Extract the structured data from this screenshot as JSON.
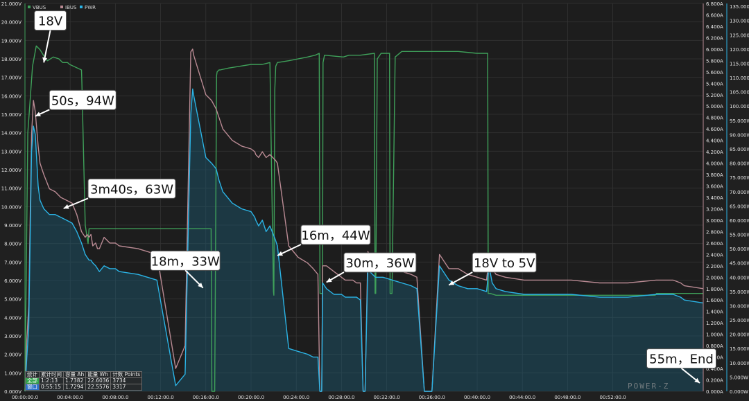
{
  "chart_data": {
    "type": "line",
    "x_unit": "elapsed time (hh:mm:ss)",
    "x_ticks": [
      "00:00:00.0",
      "00:04:00.0",
      "00:08:00.0",
      "00:12:00.0",
      "00:16:00.0",
      "00:20:00.0",
      "00:24:00.0",
      "00:28:00.0",
      "00:32:00.0",
      "00:36:00.0",
      "00:40:00.0",
      "00:44:00.0",
      "00:48:00.0",
      "00:52:00.0"
    ],
    "xlim_seconds": [
      0,
      3600
    ],
    "y_left": {
      "ylim": [
        0,
        21
      ],
      "ticks": [
        "0.000V",
        "1.000V",
        "2.000V",
        "3.000V",
        "4.000V",
        "5.000V",
        "6.000V",
        "7.000V",
        "8.000V",
        "9.000V",
        "10.000V",
        "11.000V",
        "12.000V",
        "13.000V",
        "14.000V",
        "15.000V",
        "16.000V",
        "17.000V",
        "18.000V",
        "19.000V",
        "20.000V",
        "21.000V"
      ]
    },
    "y_right1": {
      "ylim": [
        0,
        6.8
      ],
      "ticks": [
        "0.000A",
        "0.200A",
        "0.400A",
        "0.600A",
        "0.800A",
        "1.000A",
        "1.200A",
        "1.400A",
        "1.600A",
        "1.800A",
        "2.000A",
        "2.200A",
        "2.400A",
        "2.600A",
        "2.800A",
        "3.000A",
        "3.200A",
        "3.400A",
        "3.600A",
        "3.800A",
        "4.000A",
        "4.200A",
        "4.400A",
        "4.600A",
        "4.800A",
        "5.000A",
        "5.200A",
        "5.400A",
        "5.600A",
        "5.800A",
        "6.000A",
        "6.200A",
        "6.400A",
        "6.600A",
        "6.800A"
      ]
    },
    "y_right2": {
      "ylim": [
        0,
        136
      ],
      "ticks": [
        "0.000W",
        "5.000W",
        "10.000W",
        "15.000W",
        "20.000W",
        "25.000W",
        "30.000W",
        "35.000W",
        "40.000W",
        "45.000W",
        "50.000W",
        "55.000W",
        "60.000W",
        "65.000W",
        "70.000W",
        "75.000W",
        "80.000W",
        "85.000W",
        "90.000W",
        "95.000W",
        "100.000W",
        "105.000W",
        "110.000W",
        "115.000W",
        "120.000W",
        "125.000W",
        "130.000W",
        "135.000W"
      ]
    },
    "legend": [
      "VBUS",
      "IBUS",
      "PWR"
    ],
    "grid": true,
    "series": [
      {
        "name": "VBUS",
        "axis": "V",
        "color": "#3fa15a",
        "x": [
          0,
          15,
          40,
          60,
          80,
          110,
          120,
          150,
          180,
          200,
          226,
          237,
          300,
          302,
          320,
          335,
          340,
          390,
          420,
          450,
          480,
          500,
          522,
          534,
          545,
          560,
          600,
          700,
          800,
          900,
          950,
          988,
          992,
          1007,
          1017,
          1020,
          1030,
          1036,
          1080,
          1140,
          1200,
          1260,
          1300,
          1319,
          1321,
          1326,
          1331,
          1340,
          1400,
          1500,
          1540,
          1562,
          1566,
          1579,
          1582,
          1590,
          1690,
          1720,
          1740,
          1780,
          1855,
          1858,
          1862,
          1870,
          1890,
          1910,
          1935,
          1938,
          1948,
          1965,
          2000,
          2100,
          2200,
          2300,
          2400,
          2456,
          2459,
          2470,
          2500,
          2700,
          3000,
          3300,
          3345,
          3352,
          3360,
          3400,
          3500,
          3600
        ],
        "y": [
          0,
          14.0,
          17.6,
          18.7,
          18.5,
          18.0,
          17.9,
          18.1,
          18.0,
          17.8,
          17.8,
          17.7,
          17.4,
          16.8,
          9.0,
          8.0,
          8.8,
          8.8,
          8.8,
          8.8,
          8.8,
          8.8,
          8.8,
          8.8,
          8.8,
          8.8,
          8.8,
          8.8,
          8.8,
          8.8,
          8.8,
          8.8,
          0,
          0,
          17.1,
          17.3,
          17.4,
          17.4,
          17.5,
          17.6,
          17.7,
          17.7,
          17.8,
          5.4,
          5.2,
          16.3,
          17.6,
          17.8,
          17.9,
          18.1,
          18.2,
          18.3,
          5.3,
          5.3,
          17.8,
          18.2,
          18.1,
          18.2,
          18.2,
          18.2,
          18.3,
          5.3,
          5.3,
          18.0,
          18.3,
          18.3,
          18.3,
          5.3,
          5.3,
          18.1,
          18.4,
          18.4,
          18.4,
          18.4,
          18.3,
          18.3,
          5.3,
          5.3,
          5.2,
          5.2,
          5.2,
          5.2,
          5.2,
          5.3,
          5.3,
          5.3,
          5.3,
          5.3
        ]
      },
      {
        "name": "IBUS",
        "axis": "A",
        "color": "#b98a93",
        "x": [
          0,
          10,
          20,
          35,
          45,
          55,
          70,
          80,
          100,
          130,
          160,
          190,
          220,
          250,
          275,
          300,
          320,
          330,
          340,
          350,
          360,
          375,
          385,
          395,
          420,
          450,
          480,
          500,
          600,
          700,
          800,
          850,
          880,
          890,
          895,
          960,
          990,
          1015,
          1030,
          1050,
          1100,
          1150,
          1200,
          1220,
          1225,
          1240,
          1260,
          1280,
          1300,
          1330,
          1340,
          1400,
          1450,
          1500,
          1530,
          1555,
          1565,
          1575,
          1580,
          1600,
          1640,
          1680,
          1700,
          1725,
          1740,
          1760,
          1780,
          1795,
          1805,
          1820,
          1830,
          1860,
          1900,
          1950,
          2000,
          2050,
          2080,
          2120,
          2160,
          2200,
          2250,
          2300,
          2350,
          2400,
          2450,
          2463,
          2480,
          2500,
          2550,
          2650,
          2750,
          2900,
          3050,
          3200,
          3350,
          3440,
          3480,
          3500,
          3600
        ],
        "y": [
          0,
          0.9,
          1.5,
          4.5,
          5.1,
          4.9,
          4.3,
          4.0,
          3.8,
          3.55,
          3.5,
          3.4,
          3.35,
          3.3,
          3.1,
          2.8,
          2.7,
          2.75,
          2.7,
          2.75,
          2.55,
          2.6,
          2.5,
          2.5,
          2.7,
          2.6,
          2.6,
          2.55,
          2.5,
          2.4,
          0.4,
          0.8,
          5.95,
          6.0,
          5.9,
          5.2,
          5.1,
          4.95,
          4.8,
          4.6,
          4.4,
          4.3,
          4.25,
          4.2,
          4.15,
          4.1,
          4.2,
          4.1,
          4.15,
          4.05,
          4.0,
          2.55,
          2.35,
          2.25,
          2.15,
          2.05,
          0,
          0,
          2.2,
          2.2,
          2.1,
          2.0,
          1.95,
          1.95,
          1.95,
          1.9,
          1.9,
          0,
          0,
          2.45,
          2.4,
          2.3,
          2.25,
          2.2,
          2.1,
          2.05,
          2.0,
          0,
          0,
          2.4,
          2.15,
          2.15,
          2.05,
          2.0,
          1.95,
          2.35,
          2.15,
          2.05,
          2.0,
          1.95,
          1.95,
          1.95,
          1.9,
          1.9,
          1.95,
          1.95,
          1.9,
          1.85,
          1.8
        ]
      },
      {
        "name": "PWR",
        "axis": "W",
        "color": "#2bb4e6",
        "x": [
          0,
          10,
          20,
          35,
          45,
          55,
          70,
          80,
          100,
          130,
          160,
          190,
          220,
          250,
          275,
          300,
          320,
          330,
          340,
          350,
          360,
          375,
          385,
          395,
          420,
          450,
          480,
          500,
          600,
          700,
          800,
          850,
          880,
          890,
          895,
          960,
          990,
          1015,
          1030,
          1050,
          1100,
          1150,
          1200,
          1220,
          1225,
          1240,
          1260,
          1280,
          1300,
          1330,
          1340,
          1400,
          1450,
          1500,
          1530,
          1555,
          1565,
          1575,
          1580,
          1600,
          1640,
          1680,
          1700,
          1725,
          1740,
          1760,
          1780,
          1795,
          1805,
          1820,
          1830,
          1860,
          1900,
          1950,
          2000,
          2050,
          2080,
          2120,
          2160,
          2200,
          2250,
          2300,
          2350,
          2400,
          2450,
          2463,
          2480,
          2500,
          2550,
          2650,
          2750,
          2900,
          3050,
          3200,
          3350,
          3440,
          3480,
          3500,
          3600
        ],
        "y": [
          0,
          12,
          22,
          84,
          93,
          90,
          72,
          67,
          64,
          62,
          62,
          61,
          60,
          59,
          56,
          52,
          48,
          47,
          46,
          46,
          45,
          44,
          43,
          42,
          44,
          43,
          43,
          42,
          41,
          39,
          2,
          6,
          97,
          106,
          104,
          82,
          80,
          78,
          74,
          70,
          66,
          64,
          63,
          61,
          60,
          58,
          60,
          56,
          58,
          53,
          51,
          15,
          14,
          13,
          12,
          12,
          0,
          0,
          38,
          36,
          34,
          34,
          33,
          33,
          33,
          33,
          32,
          0,
          0,
          44,
          42,
          40,
          40,
          39,
          38,
          37,
          36,
          0,
          0,
          44,
          39,
          37,
          36,
          36,
          35,
          44,
          38,
          36,
          35,
          34,
          34,
          34,
          33,
          33,
          34,
          34,
          33,
          32,
          31
        ]
      }
    ],
    "annotations": [
      "18V",
      "50s，94W",
      "3m40s，63W",
      "18m，33W",
      "16m，44W",
      "30m，36W",
      "18V to 5V",
      "55m，End"
    ]
  },
  "stats": {
    "headers": [
      "统计",
      "累计时间",
      "容量 Ah",
      "能量 Wh",
      "计数 Points"
    ],
    "rows": [
      [
        "全部",
        "1:2:13",
        "1.7382",
        "22.6036",
        "3734"
      ],
      [
        "窗口",
        "0:55:15",
        "1.7294",
        "22.5576",
        "3317"
      ]
    ]
  },
  "logo": "POWER-Z"
}
